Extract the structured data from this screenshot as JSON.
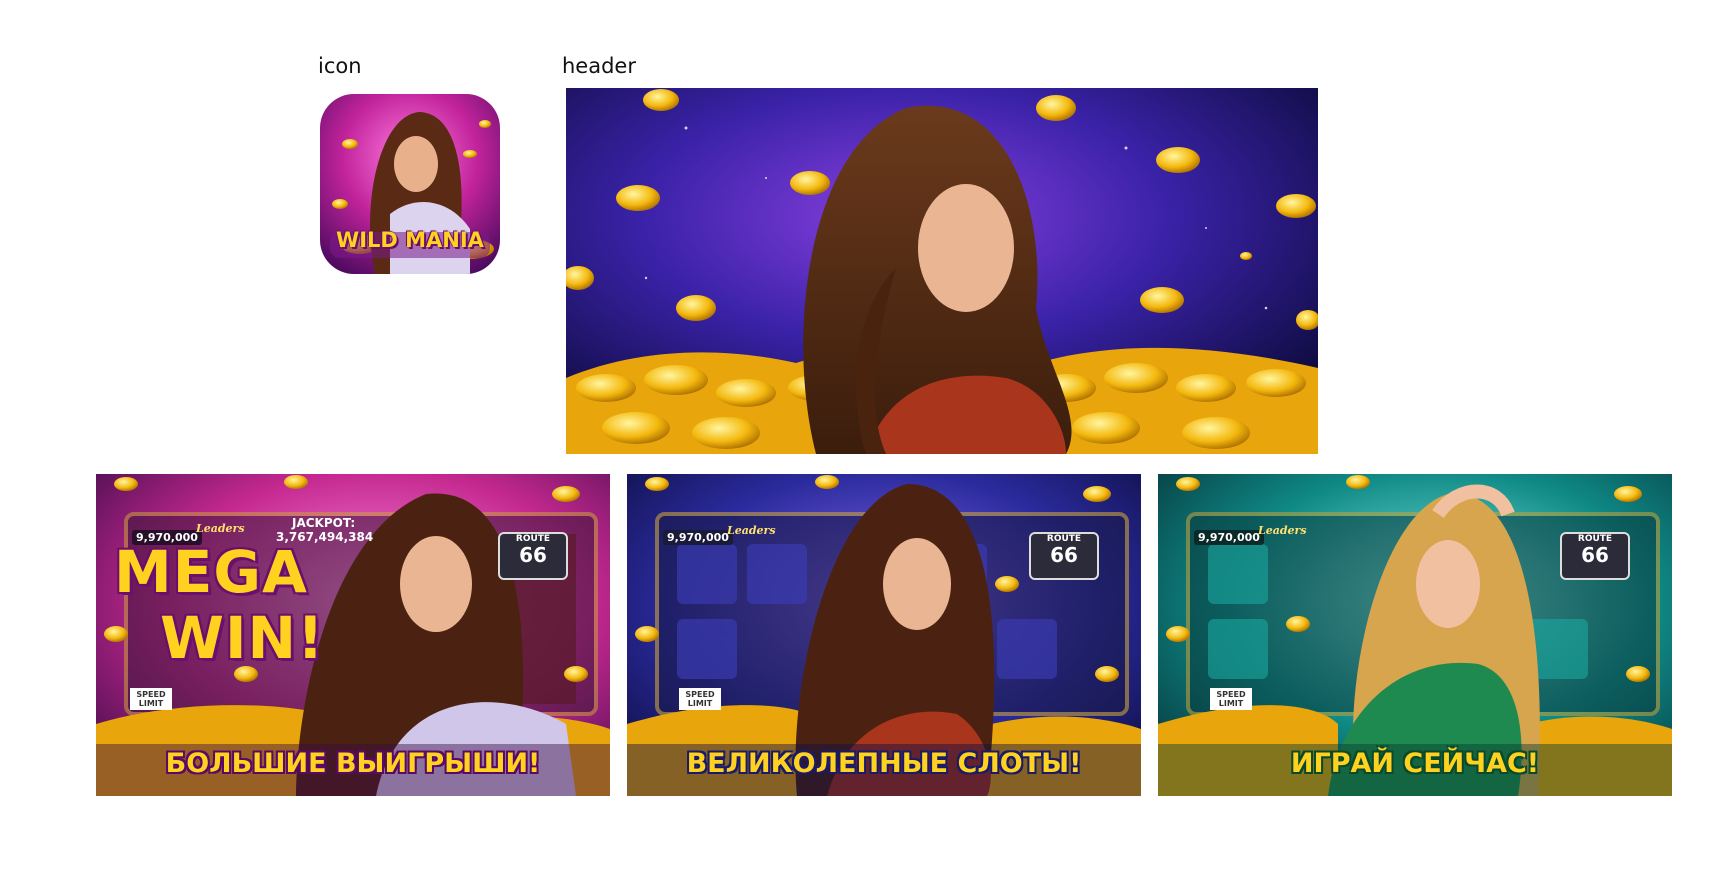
{
  "labels": {
    "icon": "icon",
    "header": "header"
  },
  "app_icon": {
    "title": "WILD MANIA",
    "bg_color": "#c2239c"
  },
  "header_banner": {
    "bg_color": "#1e1573"
  },
  "screenshots": [
    {
      "theme": "pink",
      "bg_color": "#c4288f",
      "headline_line1": "MEGA",
      "headline_line2": "WIN!",
      "slogan": "БОЛЬШИЕ ВЫИГРЫШИ!",
      "slot_ui": {
        "balance": "9,970,000",
        "leaders": "Leaders",
        "jackpot_label": "JACKPOT:",
        "jackpot_value": "3,767,494,384",
        "route": "ROUTE",
        "route_number": "66",
        "sign": "SPEED LIMIT"
      }
    },
    {
      "theme": "blue",
      "bg_color": "#2a2a9c",
      "slogan": "ВЕЛИКОЛЕПНЫЕ СЛОТЫ!",
      "slot_ui": {
        "balance": "9,970,000",
        "leaders": "Leaders",
        "route": "ROUTE",
        "route_number": "66",
        "sign": "SPEED LIMIT"
      }
    },
    {
      "theme": "teal",
      "bg_color": "#0f8a86",
      "slogan": "ИГРАЙ СЕЙЧАС!",
      "slot_ui": {
        "balance": "9,970,000",
        "leaders": "Leaders",
        "route": "ROUTE",
        "route_number": "66",
        "sign": "SPEED LIMIT"
      }
    }
  ]
}
